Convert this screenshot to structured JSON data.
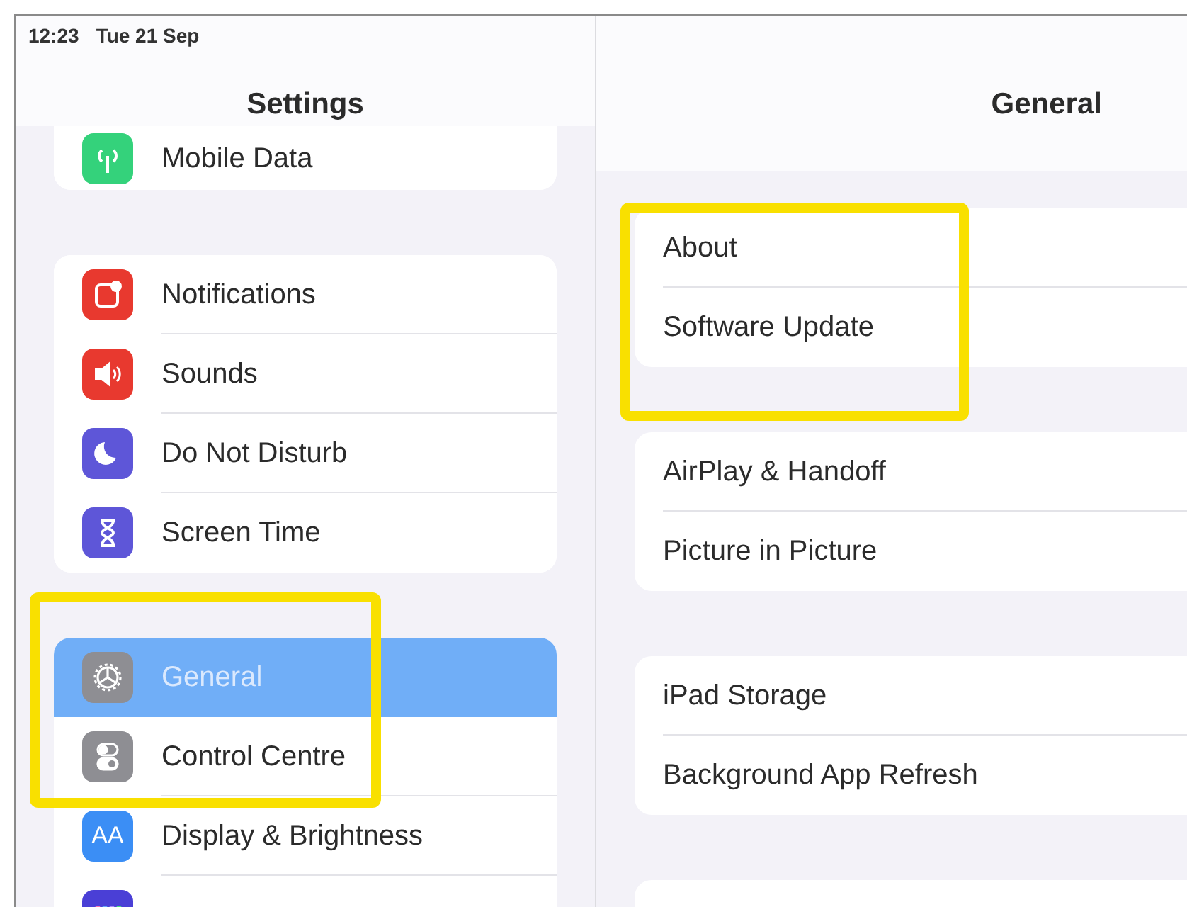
{
  "status_bar": {
    "time": "12:23",
    "date": "Tue 21 Sep"
  },
  "sidebar": {
    "title": "Settings",
    "groups": [
      {
        "items": [
          {
            "label": "Mobile Data",
            "selected": false,
            "highlighted": false
          }
        ]
      },
      {
        "items": [
          {
            "label": "Notifications",
            "selected": false,
            "highlighted": false
          },
          {
            "label": "Sounds",
            "selected": false,
            "highlighted": false
          },
          {
            "label": "Do Not Disturb",
            "selected": false,
            "highlighted": false
          },
          {
            "label": "Screen Time",
            "selected": false,
            "highlighted": false
          }
        ]
      },
      {
        "items": [
          {
            "label": "General",
            "selected": true,
            "highlighted": true
          },
          {
            "label": "Control Centre",
            "selected": false,
            "highlighted": true
          },
          {
            "icon_text": "AA",
            "label": "Display & Brightness",
            "selected": false,
            "highlighted": false
          },
          {
            "selected": false,
            "highlighted": false
          }
        ]
      }
    ]
  },
  "detail": {
    "title": "General",
    "groups": [
      {
        "highlighted": true,
        "items": [
          {
            "label": "About"
          },
          {
            "label": "Software Update"
          }
        ]
      },
      {
        "highlighted": false,
        "items": [
          {
            "label": "AirPlay & Handoff"
          },
          {
            "label": "Picture in Picture"
          }
        ]
      },
      {
        "highlighted": false,
        "items": [
          {
            "label": "iPad Storage"
          },
          {
            "label": "Background App Refresh"
          }
        ]
      },
      {
        "highlighted": false
      }
    ]
  }
}
